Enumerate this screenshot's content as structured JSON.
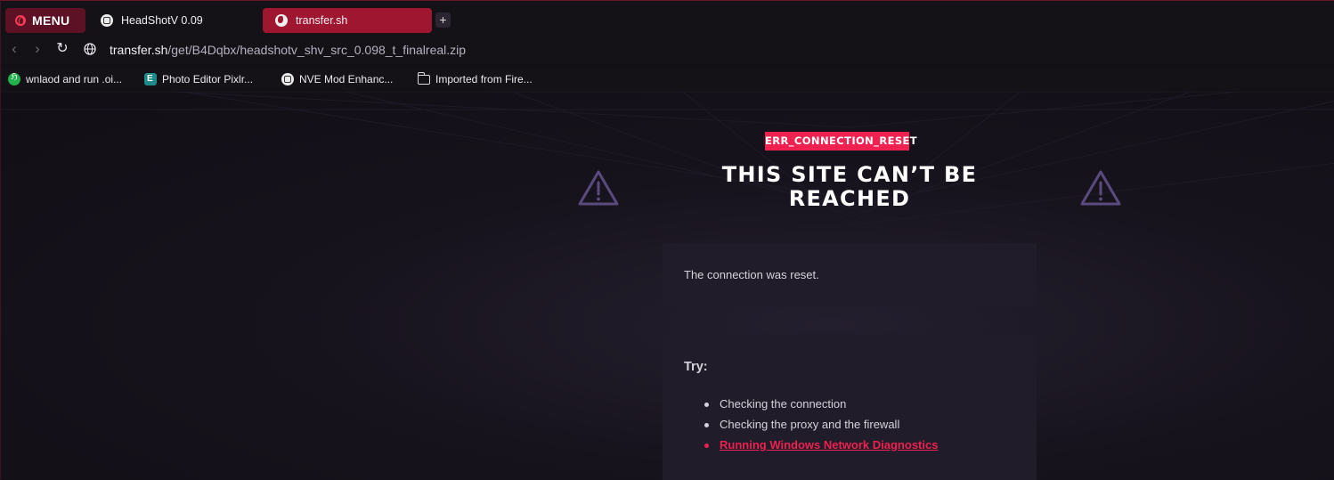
{
  "browser": {
    "menu_label": "MENU",
    "tabs": [
      {
        "title": "HeadShotV 0.09",
        "icon": "chatgpt-icon",
        "active": false
      },
      {
        "title": "transfer.sh",
        "icon": "globe-icon",
        "active": true
      }
    ],
    "new_tab_label": "+",
    "address": {
      "host": "transfer.sh",
      "path": "/get/B4Dqbx/headshotv_shv_src_0.098_t_finalreal.zip"
    },
    "bookmarks": [
      {
        "label": "wnlaod and run .oi...",
        "icon": "script-icon"
      },
      {
        "label": "Photo Editor Pixlr...",
        "icon": "pixlr-icon"
      },
      {
        "label": "NVE Mod Enhanc...",
        "icon": "chatgpt-icon"
      },
      {
        "label": "Imported from Fire...",
        "icon": "folder-icon"
      }
    ]
  },
  "error_page": {
    "code": "ERR_CONNECTION_RESET",
    "title": "THIS SITE CAN’T BE REACHED",
    "message": "The connection was reset.",
    "try_heading": "Try:",
    "suggestions": [
      "Checking the connection",
      "Checking the proxy and the firewall",
      "Running Windows Network Diagnostics"
    ]
  },
  "colors": {
    "accent": "#ee2150",
    "active_tab": "#9e1630",
    "menu_bg": "#5c1224",
    "background": "#120f17",
    "card": "#211c29",
    "warning_icon": "#5b4a7e"
  }
}
